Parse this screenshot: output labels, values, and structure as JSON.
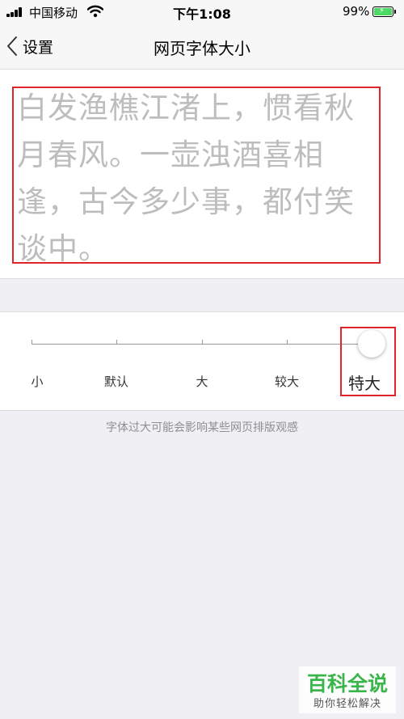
{
  "status_bar": {
    "carrier": "中国移动",
    "time": "下午1:08",
    "battery": "99%"
  },
  "nav": {
    "back_label": "设置",
    "title": "网页字体大小"
  },
  "preview": {
    "lines": [
      "白发渔樵江渚上，惯看秋",
      "月春风。一壶浊酒喜相",
      "逢，古今多少事，都付笑",
      "谈中。"
    ]
  },
  "slider": {
    "levels": [
      "小",
      "默认",
      "大",
      "较大",
      "特大"
    ],
    "selected_index": 4
  },
  "hint": "字体过大可能会影响某些网页排版观感",
  "watermark": {
    "title": "百科全说",
    "subtitle": "助你轻松解决"
  },
  "colors": {
    "highlight_box": "#e0242b",
    "preview_text": "#bdbdbd",
    "battery": "#4cd964",
    "watermark": "#3ab54a"
  }
}
